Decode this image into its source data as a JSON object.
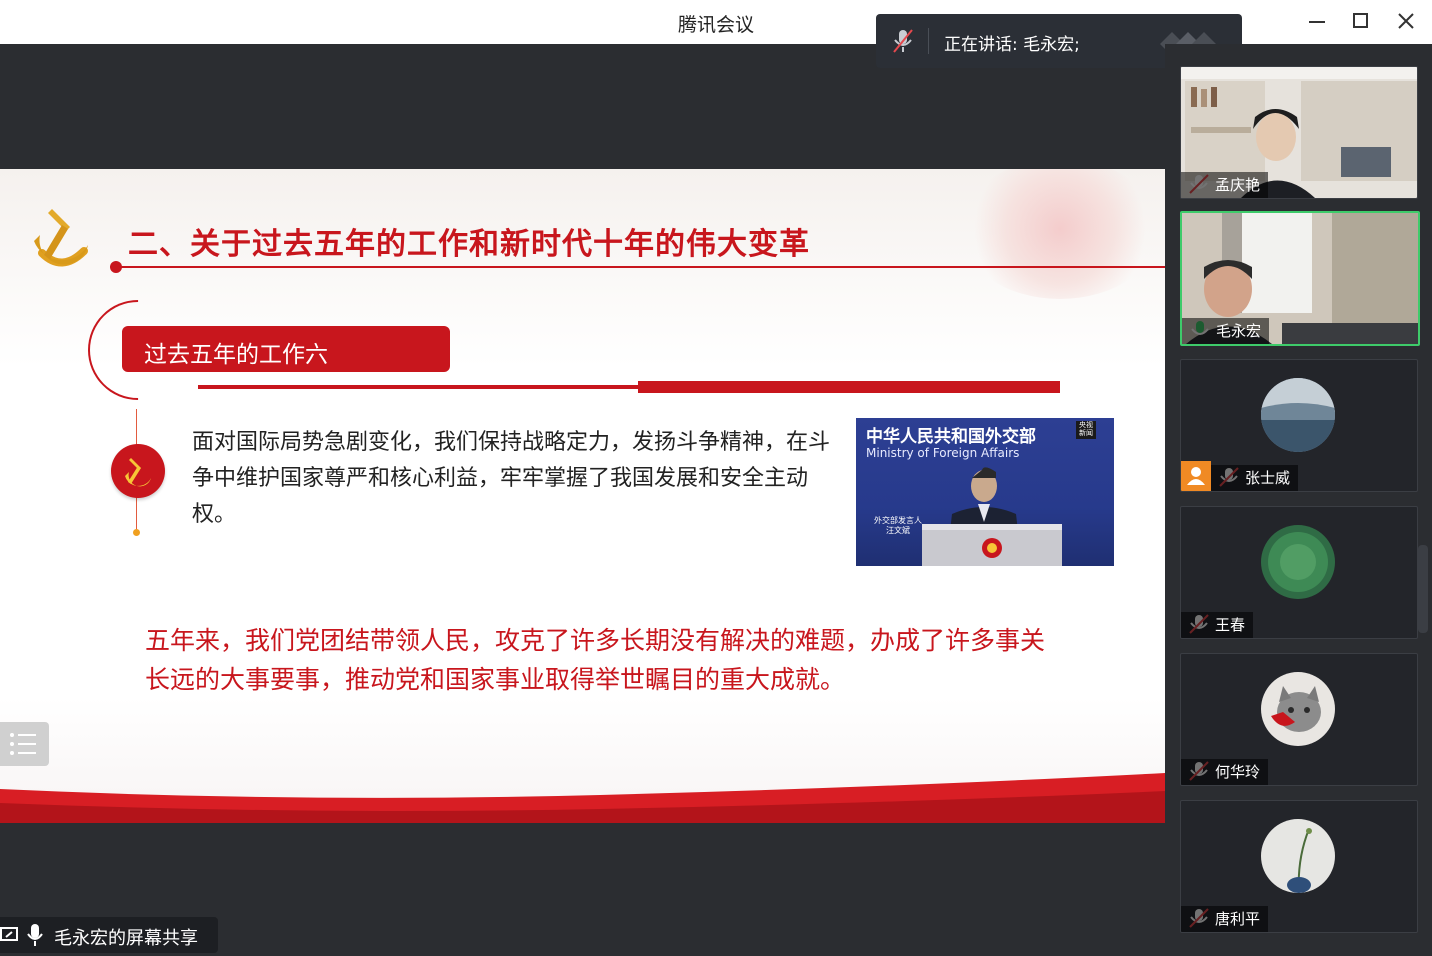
{
  "window": {
    "title": "腾讯会议"
  },
  "speaking_banner": {
    "text": "正在讲话: 毛永宏;"
  },
  "slide": {
    "title": "二、关于过去五年的工作和新时代十年的伟大变革",
    "section_label": "过去五年的工作六",
    "body": "面对国际局势急剧变化，我们保持战略定力，发扬斗争精神，在斗争中维护国家尊严和核心利益，牢牢掌握了我国发展和安全主动权。",
    "photo": {
      "title": "中华人民共和国外交部",
      "subtitle": "Ministry of Foreign Affairs",
      "badge": "外交部发言人\n汪文斌",
      "logo": "央视\n新闻"
    },
    "highlight": "五年来，我们党团结带领人民，攻克了许多长期没有解决的难题，办成了许多事关长远的大事要事，推动党和国家事业取得举世瞩目的重大成就。"
  },
  "share_label": "毛永宏的屏幕共享",
  "participants": [
    {
      "name": "孟庆艳",
      "muted": true
    },
    {
      "name": "毛永宏",
      "muted": false,
      "speaking": true
    },
    {
      "name": "张士威",
      "muted": true
    },
    {
      "name": "王春",
      "muted": true
    },
    {
      "name": "何华玲",
      "muted": true
    },
    {
      "name": "唐利平",
      "muted": true
    }
  ],
  "colors": {
    "accent_red": "#c8161d",
    "speaking_green": "#3ecb6a",
    "dark_bg": "#2b2d31"
  },
  "icons": [
    "mic-muted-icon",
    "mic-on-icon",
    "minimize-icon",
    "maximize-icon",
    "close-icon",
    "list-icon",
    "screen-share-icon",
    "user-icon"
  ]
}
